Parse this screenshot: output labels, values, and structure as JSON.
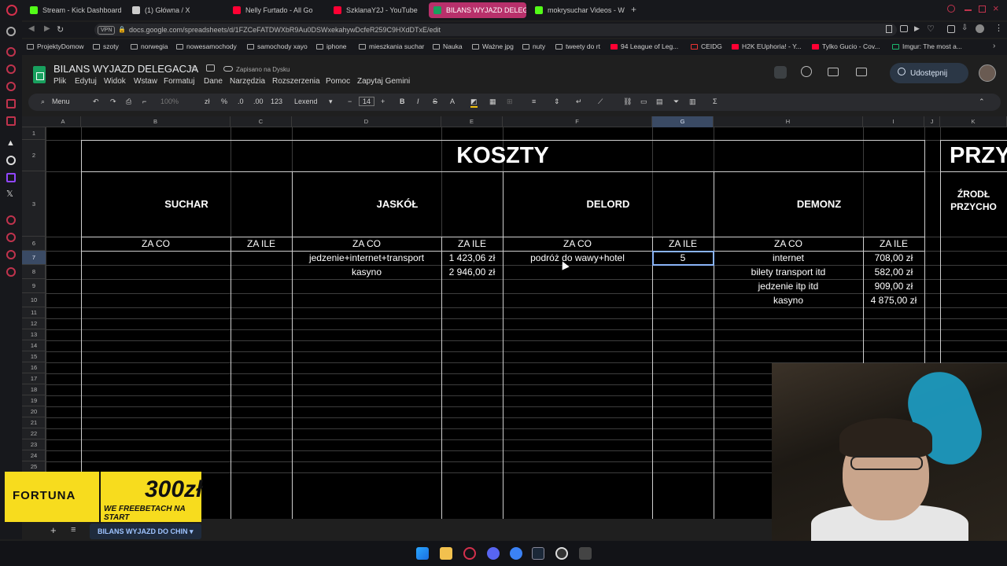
{
  "browser": {
    "tabs": [
      {
        "label": "Stream - Kick Dashboard",
        "color": "#53fc18"
      },
      {
        "label": "(1) Główna / X",
        "color": "#cccccc"
      },
      {
        "label": "Nelly Furtado - All Go",
        "color": "#ff0033"
      },
      {
        "label": "SzklanaY2J - YouTube",
        "color": "#ff0033"
      },
      {
        "label": "BILANS WYJAZD DELEG",
        "color": "#18a05e"
      },
      {
        "label": "mokrysuchar Videos - W",
        "color": "#53fc18"
      }
    ],
    "url": "docs.google.com/spreadsheets/d/1FZCeFATDWXbR9Au0DSWxekahywDcfeR259C9HXdDTxE/edit",
    "vpn": "VPN",
    "bookmarks": [
      "ProjektyDomow",
      "szoty",
      "norwegia",
      "nowesamochody",
      "samochody xayo",
      "iphone",
      "mieszkania suchar",
      "Nauka",
      "Ważne jpg",
      "nuty",
      "tweety do rt",
      "94 League of Leg...",
      "CEIDG",
      "H2K EUphoria! - Y...",
      "Tylko Gucio - Cov...",
      "Imgur: The most a..."
    ]
  },
  "app": {
    "title": "BILANS WYJAZD DELEGACJA",
    "saved": "Zapisano na Dysku",
    "menus": [
      "Plik",
      "Edytuj",
      "Widok",
      "Wstaw",
      "Formatuj",
      "Dane",
      "Narzędzia",
      "Rozszerzenia",
      "Pomoc",
      "Zapytaj Gemini"
    ],
    "share": "Udostępnij"
  },
  "toolbar": {
    "search": "Menu",
    "zoom": "100%",
    "currency": "zł",
    "percent": "%",
    "dec_less": ".0",
    "dec_more": ".00",
    "format": "123",
    "font": "Lexend",
    "size": "14",
    "bold": "B",
    "italic": "I",
    "strike": "S",
    "color": "A",
    "sum": "Σ"
  },
  "columns": [
    "A",
    "B",
    "C",
    "D",
    "E",
    "F",
    "G",
    "H",
    "I",
    "J",
    "K"
  ],
  "rows": [
    "1",
    "2",
    "3",
    "6",
    "7",
    "8",
    "9",
    "10",
    "11",
    "12",
    "13",
    "14",
    "15",
    "16",
    "17",
    "18",
    "19",
    "20",
    "21",
    "22",
    "23",
    "24",
    "25"
  ],
  "sheet": {
    "title": "KOSZTY",
    "right_title": "PRZY",
    "right_sub1": "ŹRODŁ",
    "right_sub2": "PRZYCHO",
    "persons": [
      "SUCHAR",
      "JASKÓŁ",
      "DELORD",
      "DEMONZ"
    ],
    "col_co": "ZA CO",
    "col_ile": "ZA ILE",
    "suchar": [],
    "jaskol": [
      {
        "co": "jedzenie+internet+transport",
        "ile": "1 423,06 zł"
      },
      {
        "co": "kasyno",
        "ile": "2 946,00 zł"
      }
    ],
    "delord": [
      {
        "co": "podróż do wawy+hotel",
        "ile": "5"
      }
    ],
    "demonz": [
      {
        "co": "internet",
        "ile": "708,00 zł"
      },
      {
        "co": "bilety transport itd",
        "ile": "582,00 zł"
      },
      {
        "co": "jedzenie itp itd",
        "ile": "909,00 zł"
      },
      {
        "co": "kasyno",
        "ile": "4 875,00 zł"
      }
    ]
  },
  "sheet_tab": "BILANS WYJAZD DO CHIN",
  "ad": {
    "brand": "FORTUNA",
    "amount": "300zł",
    "tagline": "WE FREEBETACH NA START"
  }
}
